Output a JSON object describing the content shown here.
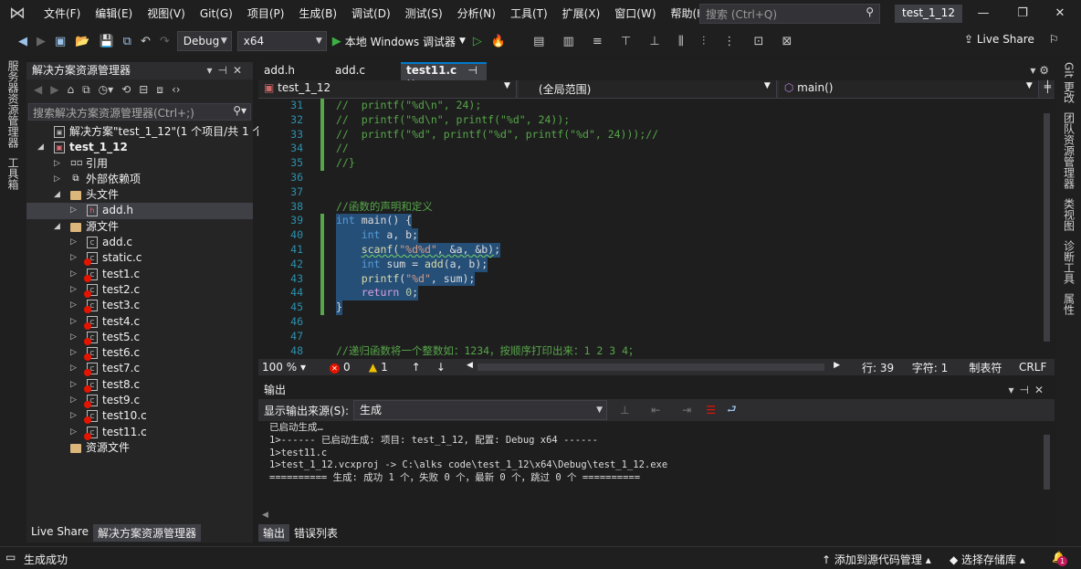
{
  "menubar": {
    "items": [
      "文件(F)",
      "编辑(E)",
      "视图(V)",
      "Git(G)",
      "项目(P)",
      "生成(B)",
      "调试(D)",
      "测试(S)",
      "分析(N)",
      "工具(T)",
      "扩展(X)",
      "窗口(W)",
      "帮助(H)"
    ],
    "search_placeholder": "搜索 (Ctrl+Q)",
    "project_name": "test_1_12"
  },
  "toolbar": {
    "config": "Debug",
    "platform": "x64",
    "run_label": "本地 Windows 调试器",
    "live_share": "Live Share"
  },
  "left_strip": [
    "服务器资源管理器",
    "工具箱"
  ],
  "right_strip": [
    "Git 更改",
    "团队资源管理器",
    "类视图",
    "诊断工具",
    "属性"
  ],
  "solution_explorer": {
    "title": "解决方案资源管理器",
    "search_placeholder": "搜索解决方案资源管理器(Ctrl+;)",
    "tree": [
      {
        "label": "解决方案\"test_1_12\"(1 个项目/共 1 个)",
        "icon": "solution-icon",
        "level": 0,
        "exp": ""
      },
      {
        "label": "test_1_12",
        "icon": "project-icon",
        "level": 0,
        "exp": "open",
        "bold": true
      },
      {
        "label": "引用",
        "icon": "references-icon",
        "level": 1,
        "exp": "closed"
      },
      {
        "label": "外部依赖项",
        "icon": "external-deps-icon",
        "level": 1,
        "exp": "closed"
      },
      {
        "label": "头文件",
        "icon": "folder-icon",
        "level": 1,
        "exp": "open"
      },
      {
        "label": "add.h",
        "icon": "header-file-icon",
        "level": 2,
        "exp": "closed",
        "selected": true
      },
      {
        "label": "源文件",
        "icon": "folder-icon",
        "level": 1,
        "exp": "open"
      },
      {
        "label": "add.c",
        "icon": "c-file-icon",
        "level": 2,
        "exp": "closed"
      },
      {
        "label": "static.c",
        "icon": "c-file-excluded-icon",
        "level": 2,
        "exp": "closed"
      },
      {
        "label": "test1.c",
        "icon": "c-file-excluded-icon",
        "level": 2,
        "exp": "closed"
      },
      {
        "label": "test2.c",
        "icon": "c-file-excluded-icon",
        "level": 2,
        "exp": "closed"
      },
      {
        "label": "test3.c",
        "icon": "c-file-excluded-icon",
        "level": 2,
        "exp": "closed"
      },
      {
        "label": "test4.c",
        "icon": "c-file-excluded-icon",
        "level": 2,
        "exp": "closed"
      },
      {
        "label": "test5.c",
        "icon": "c-file-excluded-icon",
        "level": 2,
        "exp": "closed"
      },
      {
        "label": "test6.c",
        "icon": "c-file-excluded-icon",
        "level": 2,
        "exp": "closed"
      },
      {
        "label": "test7.c",
        "icon": "c-file-excluded-icon",
        "level": 2,
        "exp": "closed"
      },
      {
        "label": "test8.c",
        "icon": "c-file-excluded-icon",
        "level": 2,
        "exp": "closed"
      },
      {
        "label": "test9.c",
        "icon": "c-file-excluded-icon",
        "level": 2,
        "exp": "closed"
      },
      {
        "label": "test10.c",
        "icon": "c-file-excluded-icon",
        "level": 2,
        "exp": "closed"
      },
      {
        "label": "test11.c",
        "icon": "c-file-excluded-icon",
        "level": 2,
        "exp": "closed"
      },
      {
        "label": "资源文件",
        "icon": "folder-icon",
        "level": 1,
        "exp": ""
      }
    ],
    "bottom_tabs": [
      "Live Share",
      "解决方案资源管理器"
    ]
  },
  "editor": {
    "tabs": [
      "add.h",
      "add.c",
      "test11.c"
    ],
    "active_tab": 2,
    "nav": {
      "project": "test_1_12",
      "scope": "(全局范围)",
      "member": "main()"
    },
    "lines": [
      {
        "n": 31,
        "chg": true,
        "tokens": [
          {
            "t": "//  printf(\"%d\\n\", 24);",
            "c": "comment"
          }
        ]
      },
      {
        "n": 32,
        "chg": true,
        "tokens": [
          {
            "t": "//  printf(\"%d\\n\", printf(\"%d\", 24));",
            "c": "comment"
          }
        ]
      },
      {
        "n": 33,
        "chg": true,
        "tokens": [
          {
            "t": "//  printf(\"%d\", printf(\"%d\", printf(\"%d\", 24)));//",
            "c": "comment"
          }
        ]
      },
      {
        "n": 34,
        "chg": true,
        "tokens": [
          {
            "t": "//",
            "c": "comment"
          }
        ]
      },
      {
        "n": 35,
        "chg": true,
        "tokens": [
          {
            "t": "//}",
            "c": "comment"
          }
        ]
      },
      {
        "n": 36,
        "tokens": []
      },
      {
        "n": 37,
        "tokens": []
      },
      {
        "n": 38,
        "tokens": [
          {
            "t": "//函数的声明和定义",
            "c": "comment"
          }
        ]
      },
      {
        "n": 39,
        "chg": true,
        "sel": true,
        "tokens": [
          {
            "t": "int",
            "c": "kw"
          },
          {
            "t": " main() {",
            "c": "plain"
          }
        ]
      },
      {
        "n": 40,
        "chg": true,
        "sel": true,
        "tokens": [
          {
            "t": "    ",
            "c": "plain"
          },
          {
            "t": "int",
            "c": "kw"
          },
          {
            "t": " a, b;",
            "c": "plain"
          }
        ]
      },
      {
        "n": 41,
        "chg": true,
        "sel": true,
        "tokens": [
          {
            "t": "    ",
            "c": "plain"
          },
          {
            "t": "scanf(",
            "c": "fn",
            "sq": true
          },
          {
            "t": "\"%d%d\"",
            "c": "str",
            "sq": true
          },
          {
            "t": ", &a, &b)",
            "c": "plain",
            "sq": true
          },
          {
            "t": ";",
            "c": "plain"
          }
        ]
      },
      {
        "n": 42,
        "chg": true,
        "sel": true,
        "tokens": [
          {
            "t": "    ",
            "c": "plain"
          },
          {
            "t": "int",
            "c": "kw"
          },
          {
            "t": " sum = ",
            "c": "plain"
          },
          {
            "t": "add",
            "c": "fn"
          },
          {
            "t": "(a, b);",
            "c": "plain"
          }
        ]
      },
      {
        "n": 43,
        "chg": true,
        "sel": true,
        "tokens": [
          {
            "t": "    ",
            "c": "plain"
          },
          {
            "t": "printf",
            "c": "fn"
          },
          {
            "t": "(",
            "c": "plain"
          },
          {
            "t": "\"%d\"",
            "c": "str"
          },
          {
            "t": ", sum);",
            "c": "plain"
          }
        ]
      },
      {
        "n": 44,
        "chg": true,
        "sel": true,
        "tokens": [
          {
            "t": "    ",
            "c": "plain"
          },
          {
            "t": "return",
            "c": "ret"
          },
          {
            "t": " ",
            "c": "plain"
          },
          {
            "t": "0",
            "c": "num"
          },
          {
            "t": ";",
            "c": "plain"
          }
        ]
      },
      {
        "n": 45,
        "chg": true,
        "sel": true,
        "tokens": [
          {
            "t": "}",
            "c": "plain"
          }
        ]
      },
      {
        "n": 46,
        "tokens": []
      },
      {
        "n": 47,
        "tokens": []
      },
      {
        "n": 48,
        "tokens": [
          {
            "t": "//递归函数将一个整数如：1234，按顺序打印出来：1 2 3 4；",
            "c": "comment"
          }
        ]
      }
    ],
    "status": {
      "zoom": "100 %",
      "errors": "0",
      "warnings": "1",
      "line": "行: 39",
      "char": "字符: 1",
      "indent": "制表符",
      "eol": "CRLF"
    }
  },
  "output": {
    "title": "输出",
    "source_label": "显示输出来源(S):",
    "source_value": "生成",
    "lines": [
      "已启动生成…",
      "1>------ 已启动生成: 项目: test_1_12, 配置: Debug x64 ------",
      "1>test11.c",
      "1>test_1_12.vcxproj -> C:\\alks code\\test_1_12\\x64\\Debug\\test_1_12.exe",
      "========== 生成: 成功 1 个，失败 0 个，最新 0 个，跳过 0 个 =========="
    ],
    "tabs": [
      "输出",
      "错误列表"
    ]
  },
  "statusbar": {
    "left": "生成成功",
    "add_source": "添加到源代码管理",
    "select_repo": "选择存储库",
    "notifications": "1"
  },
  "colors": {
    "accent": "#007acc",
    "comment": "#57a64a",
    "keyword": "#569cd6",
    "string": "#d69d85",
    "selection": "#264f78"
  }
}
